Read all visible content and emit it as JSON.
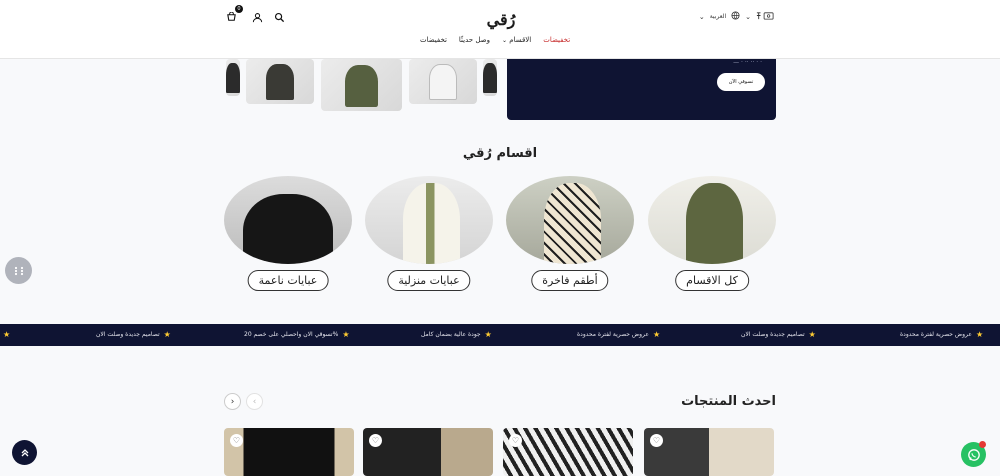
{
  "header": {
    "logo_text": "رُقي",
    "language": "العربية",
    "nav": [
      {
        "label": "تخفيضات",
        "highlight": true
      },
      {
        "label": "الاقسام",
        "dropdown": true
      },
      {
        "label": "وصل حديثًا"
      },
      {
        "label": "تخفيضات"
      }
    ]
  },
  "banner": {
    "cta": "تسوقي الآن"
  },
  "categories": {
    "title": "اقسام رُقي",
    "items": [
      {
        "label": "كل الاقسام"
      },
      {
        "label": "أطقم فاخرة"
      },
      {
        "label": "عبايات منزلية"
      },
      {
        "label": "عبايات ناعمة"
      }
    ]
  },
  "marquee": {
    "items": [
      "عروض حصرية لفترة محدودة",
      "تصاميم جديدة وصلت الان",
      "عروض حصرية لفترة محدودة",
      "جودة عالية بضمان كامل",
      "تسوقي الان واحصلي على خصم 20%",
      "تصاميم جديدة وصلت الان"
    ]
  },
  "products": {
    "title": "احدث المنتجات"
  },
  "colors": {
    "navy": "#0f1433",
    "sale_red": "#c62828",
    "whatsapp_green": "#27c163"
  }
}
